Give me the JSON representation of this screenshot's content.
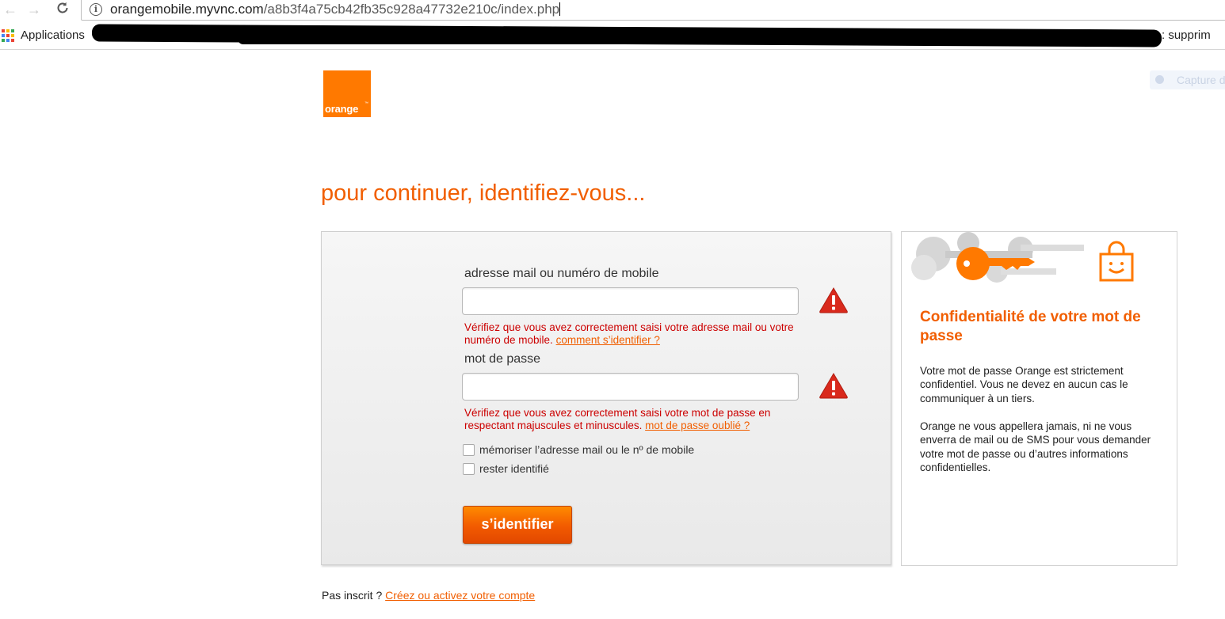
{
  "browser": {
    "url_domain": "orangemobile.myvnc.com",
    "url_path": "/a8b3f4a75cb42fb35c928a47732e210c/index.php",
    "back_icon": "←",
    "forward_icon": "→",
    "reload_icon": "C",
    "info_icon": "i",
    "bookmarks": {
      "apps_label": "Applications",
      "right_partial": ": supprim"
    },
    "capture_label": "Capture d"
  },
  "logo": {
    "text": "orange",
    "tm": "™"
  },
  "page": {
    "title": "pour continuer, identifiez-vous..."
  },
  "form": {
    "login_label": "adresse mail ou numéro de mobile",
    "login_value": "",
    "login_error": "Vérifiez que vous avez correctement saisi votre adresse mail ou votre numéro de mobile.",
    "login_help_link": "comment s’identifier ?",
    "password_label": "mot de passe",
    "password_value": "",
    "password_error": "Vérifiez que vous avez correctement saisi votre mot de passe en respectant majuscules et minuscules.",
    "password_help_link": "mot de passe oublié ?",
    "remember_label": "mémoriser l’adresse mail ou le nº de mobile",
    "remember_checked": false,
    "stay_label": "rester identifié",
    "stay_checked": false,
    "submit_label": "s’identifier"
  },
  "side": {
    "title": "Confidentialité de votre mot de passe",
    "para1": "Votre mot de passe Orange est strictement confidentiel. Vous ne devez en aucun cas le communiquer à un tiers.",
    "para2": "Orange ne vous appellera jamais, ni ne vous enverra de mail ou de SMS pour vous demander votre mot de passe ou d’autres informations confidentielles."
  },
  "footer": {
    "prefix": "Pas inscrit ?",
    "link": "Créez ou activez votre compte"
  },
  "colors": {
    "brand_orange": "#ff7900",
    "title_orange": "#f15e00",
    "error_red": "#cc0000",
    "warning_red": "#d9291c"
  }
}
